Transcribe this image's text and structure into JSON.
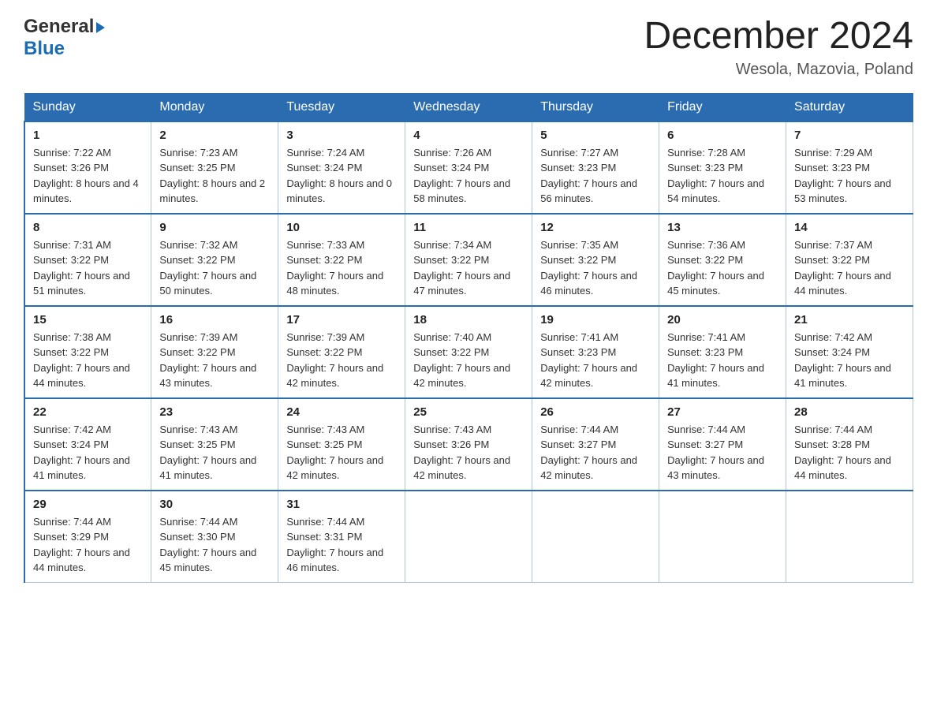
{
  "header": {
    "logo_line1": "General",
    "logo_arrow": "▶",
    "logo_line2": "Blue",
    "month_title": "December 2024",
    "location": "Wesola, Mazovia, Poland"
  },
  "days_of_week": [
    "Sunday",
    "Monday",
    "Tuesday",
    "Wednesday",
    "Thursday",
    "Friday",
    "Saturday"
  ],
  "weeks": [
    [
      {
        "num": "1",
        "sunrise": "7:22 AM",
        "sunset": "3:26 PM",
        "daylight": "8 hours and 4 minutes."
      },
      {
        "num": "2",
        "sunrise": "7:23 AM",
        "sunset": "3:25 PM",
        "daylight": "8 hours and 2 minutes."
      },
      {
        "num": "3",
        "sunrise": "7:24 AM",
        "sunset": "3:24 PM",
        "daylight": "8 hours and 0 minutes."
      },
      {
        "num": "4",
        "sunrise": "7:26 AM",
        "sunset": "3:24 PM",
        "daylight": "7 hours and 58 minutes."
      },
      {
        "num": "5",
        "sunrise": "7:27 AM",
        "sunset": "3:23 PM",
        "daylight": "7 hours and 56 minutes."
      },
      {
        "num": "6",
        "sunrise": "7:28 AM",
        "sunset": "3:23 PM",
        "daylight": "7 hours and 54 minutes."
      },
      {
        "num": "7",
        "sunrise": "7:29 AM",
        "sunset": "3:23 PM",
        "daylight": "7 hours and 53 minutes."
      }
    ],
    [
      {
        "num": "8",
        "sunrise": "7:31 AM",
        "sunset": "3:22 PM",
        "daylight": "7 hours and 51 minutes."
      },
      {
        "num": "9",
        "sunrise": "7:32 AM",
        "sunset": "3:22 PM",
        "daylight": "7 hours and 50 minutes."
      },
      {
        "num": "10",
        "sunrise": "7:33 AM",
        "sunset": "3:22 PM",
        "daylight": "7 hours and 48 minutes."
      },
      {
        "num": "11",
        "sunrise": "7:34 AM",
        "sunset": "3:22 PM",
        "daylight": "7 hours and 47 minutes."
      },
      {
        "num": "12",
        "sunrise": "7:35 AM",
        "sunset": "3:22 PM",
        "daylight": "7 hours and 46 minutes."
      },
      {
        "num": "13",
        "sunrise": "7:36 AM",
        "sunset": "3:22 PM",
        "daylight": "7 hours and 45 minutes."
      },
      {
        "num": "14",
        "sunrise": "7:37 AM",
        "sunset": "3:22 PM",
        "daylight": "7 hours and 44 minutes."
      }
    ],
    [
      {
        "num": "15",
        "sunrise": "7:38 AM",
        "sunset": "3:22 PM",
        "daylight": "7 hours and 44 minutes."
      },
      {
        "num": "16",
        "sunrise": "7:39 AM",
        "sunset": "3:22 PM",
        "daylight": "7 hours and 43 minutes."
      },
      {
        "num": "17",
        "sunrise": "7:39 AM",
        "sunset": "3:22 PM",
        "daylight": "7 hours and 42 minutes."
      },
      {
        "num": "18",
        "sunrise": "7:40 AM",
        "sunset": "3:22 PM",
        "daylight": "7 hours and 42 minutes."
      },
      {
        "num": "19",
        "sunrise": "7:41 AM",
        "sunset": "3:23 PM",
        "daylight": "7 hours and 42 minutes."
      },
      {
        "num": "20",
        "sunrise": "7:41 AM",
        "sunset": "3:23 PM",
        "daylight": "7 hours and 41 minutes."
      },
      {
        "num": "21",
        "sunrise": "7:42 AM",
        "sunset": "3:24 PM",
        "daylight": "7 hours and 41 minutes."
      }
    ],
    [
      {
        "num": "22",
        "sunrise": "7:42 AM",
        "sunset": "3:24 PM",
        "daylight": "7 hours and 41 minutes."
      },
      {
        "num": "23",
        "sunrise": "7:43 AM",
        "sunset": "3:25 PM",
        "daylight": "7 hours and 41 minutes."
      },
      {
        "num": "24",
        "sunrise": "7:43 AM",
        "sunset": "3:25 PM",
        "daylight": "7 hours and 42 minutes."
      },
      {
        "num": "25",
        "sunrise": "7:43 AM",
        "sunset": "3:26 PM",
        "daylight": "7 hours and 42 minutes."
      },
      {
        "num": "26",
        "sunrise": "7:44 AM",
        "sunset": "3:27 PM",
        "daylight": "7 hours and 42 minutes."
      },
      {
        "num": "27",
        "sunrise": "7:44 AM",
        "sunset": "3:27 PM",
        "daylight": "7 hours and 43 minutes."
      },
      {
        "num": "28",
        "sunrise": "7:44 AM",
        "sunset": "3:28 PM",
        "daylight": "7 hours and 44 minutes."
      }
    ],
    [
      {
        "num": "29",
        "sunrise": "7:44 AM",
        "sunset": "3:29 PM",
        "daylight": "7 hours and 44 minutes."
      },
      {
        "num": "30",
        "sunrise": "7:44 AM",
        "sunset": "3:30 PM",
        "daylight": "7 hours and 45 minutes."
      },
      {
        "num": "31",
        "sunrise": "7:44 AM",
        "sunset": "3:31 PM",
        "daylight": "7 hours and 46 minutes."
      },
      null,
      null,
      null,
      null
    ]
  ]
}
